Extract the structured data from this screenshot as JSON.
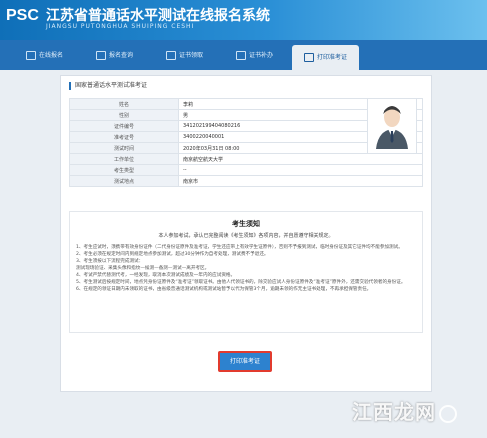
{
  "header": {
    "logo": "PSC",
    "title": "江苏省普通话水平测试在线报名系统",
    "subtitle": "JIANGSU PUTONGHUA SHUIPING CESHI"
  },
  "nav": {
    "items": [
      {
        "label": "在线报名",
        "icon": "pencil-icon"
      },
      {
        "label": "报名查询",
        "icon": "search-icon"
      },
      {
        "label": "证书领取",
        "icon": "certificate-icon"
      },
      {
        "label": "证书补办",
        "icon": "document-icon"
      },
      {
        "label": "打印准考证",
        "icon": "printer-icon"
      }
    ],
    "active": "打印准考证"
  },
  "panel": {
    "title": "国家普通话水平测试准考证"
  },
  "info": [
    {
      "label": "姓名",
      "value": "李莉"
    },
    {
      "label": "性别",
      "value": "男"
    },
    {
      "label": "证件编号",
      "value": "341202199404080216"
    },
    {
      "label": "准考证号",
      "value": "3400220040001"
    },
    {
      "label": "测试时间",
      "value": "2020年03月31日 08:00"
    },
    {
      "label": "工作单位",
      "value": "南京航空航天大学"
    },
    {
      "label": "考生类型",
      "value": "--"
    },
    {
      "label": "测试地点",
      "value": "南京市"
    }
  ],
  "notice": {
    "title": "考生须知",
    "subtitle": "本人参加考试，承认已完整阅读《考生须知》各项内容，并自愿遵守相关规定。",
    "lines": [
      "1、考生应试时，须携带有效身份证件（二代身份证原件及准考证，学生还应带上有效学生证原件），否则不予报到测试，临时身份证及其它证件均不能参加测试。",
      "2、考生必须在规定时间内到规定地点参加测试，超过30分钟作为自考处理，测试费不予退还。",
      "3、考生须按以下流程完成测试：",
      "测试现场验证、采集头像和指纹—候测—备测—测试—离开考区。",
      "4、考试严禁代替测代考，一经发现，取消本次测试成绩及一年内的应试资格。",
      "5、考生测试后按规定时间，地点凭身份证原件及“准考证”领取证书。由他人代领证书的，除交验应试人身份证原件及“准考证”原件外，还需交验代领者的身份证。",
      "6、在规定的领证日期内未领取的证书，由省级普通话测试机构或测试站暂予以代为保管3个月，逾期未领的作无主证书处理，不再承担保管责任。"
    ]
  },
  "print_button": "打印准考证",
  "watermark": "江西龙网"
}
